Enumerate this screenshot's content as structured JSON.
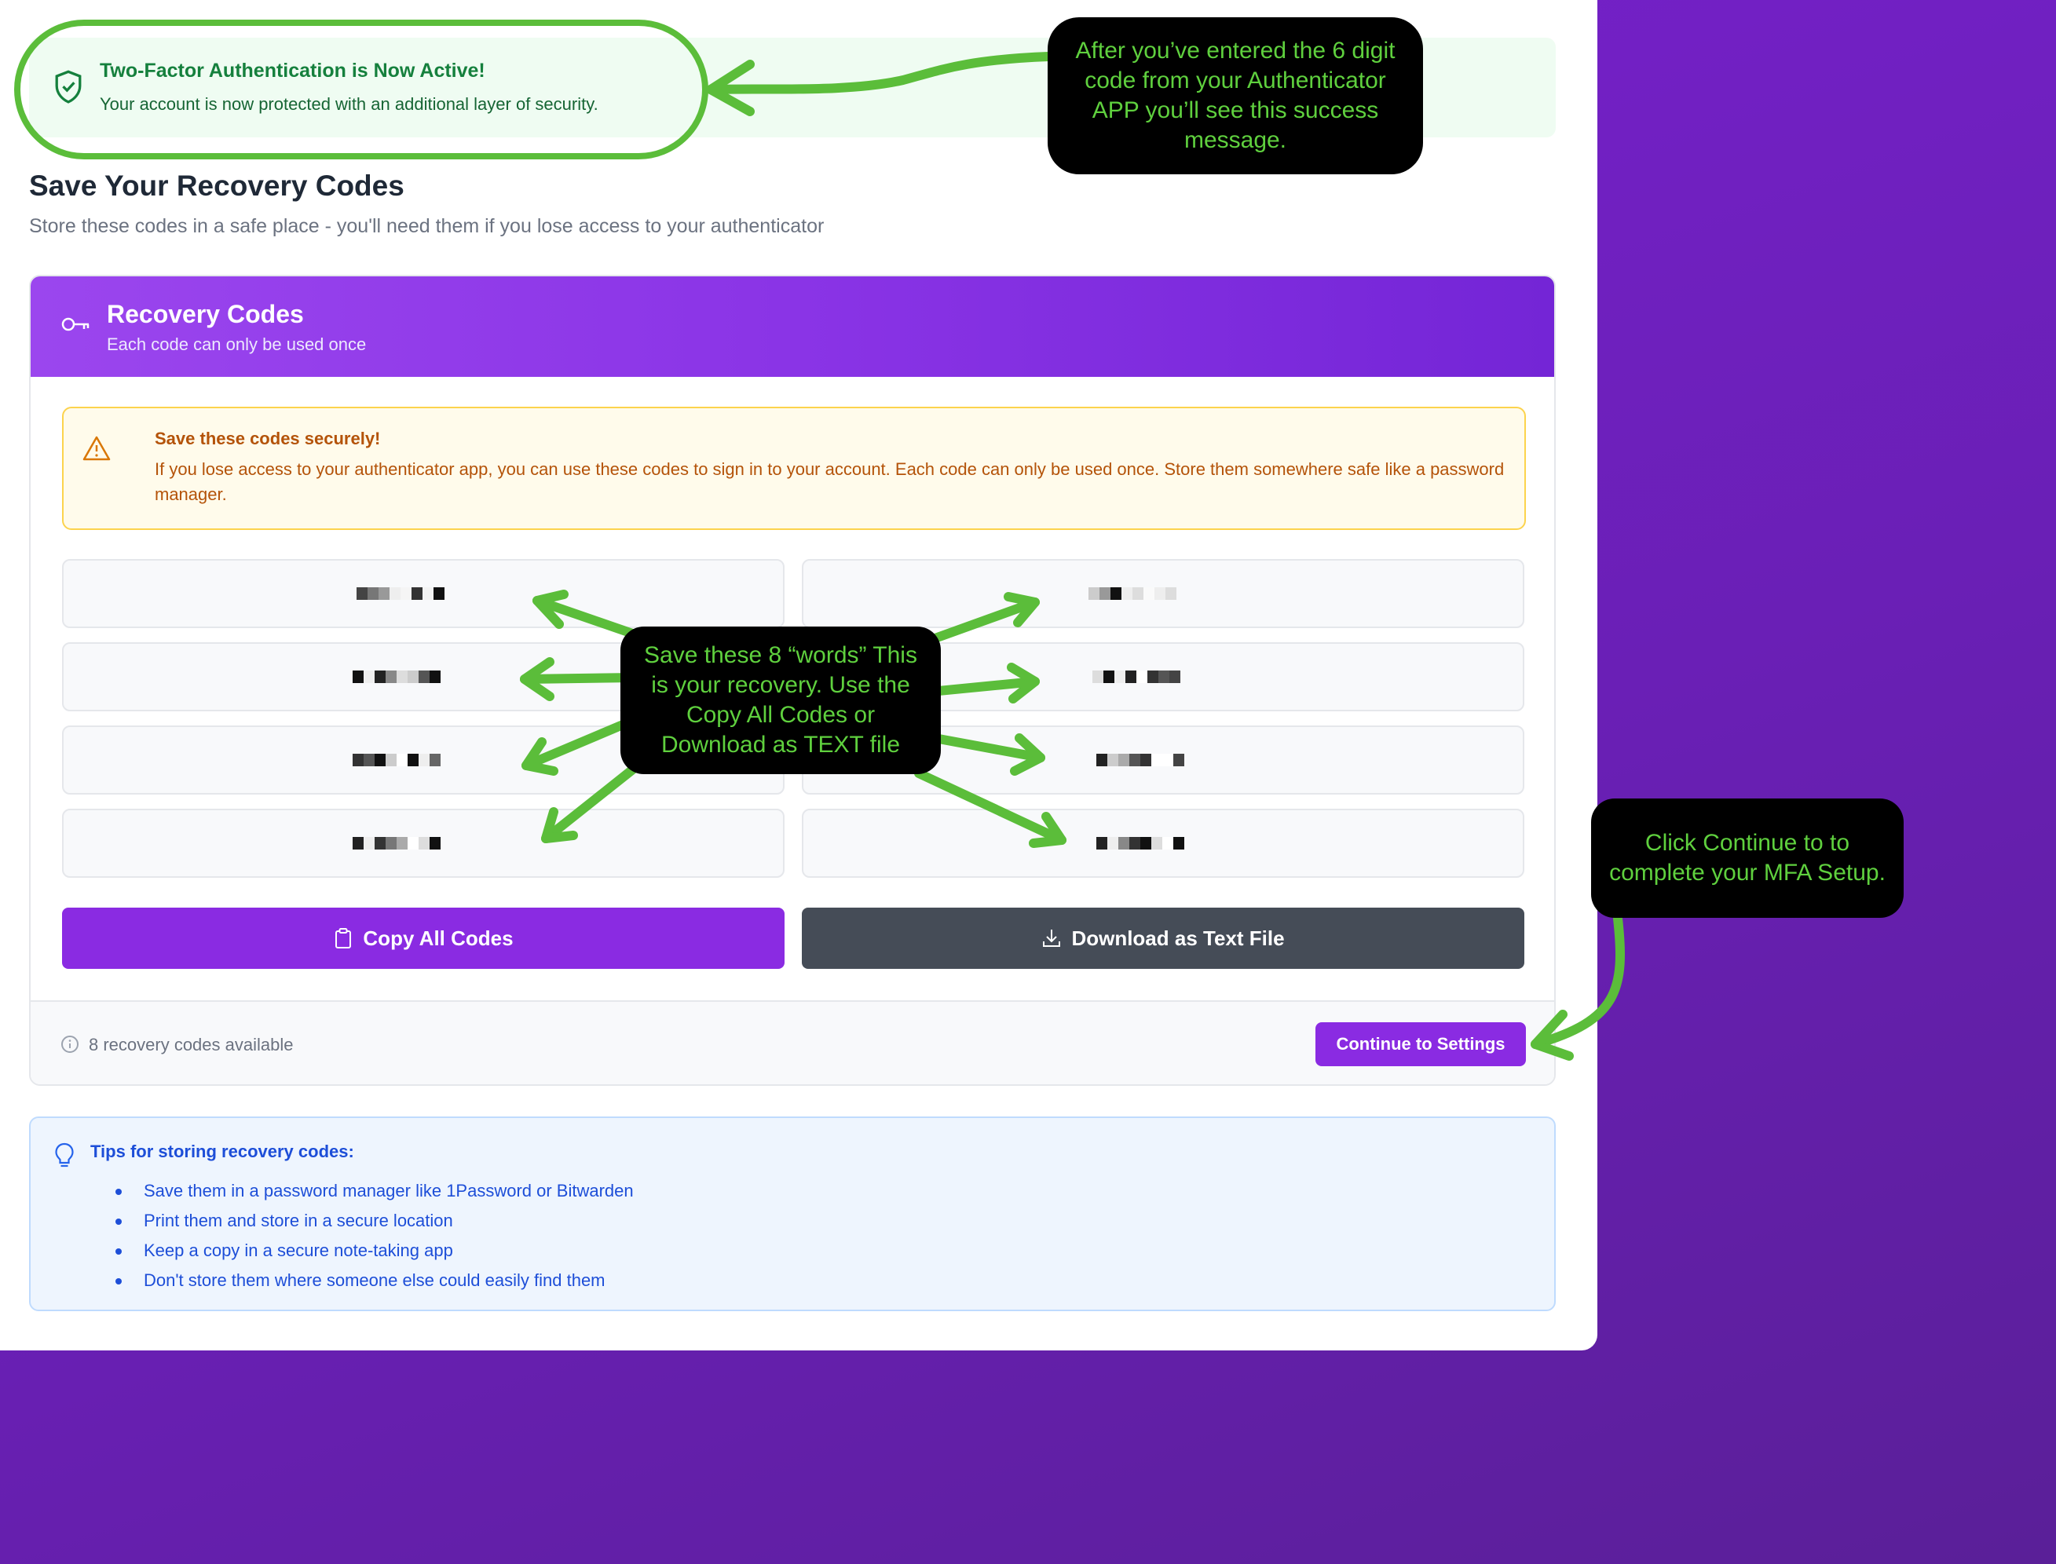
{
  "success": {
    "title": "Two-Factor Authentication is Now Active!",
    "description": "Your account is now protected with an additional layer of security."
  },
  "header": {
    "title": "Save Your Recovery Codes",
    "subtitle": "Store these codes in a safe place - you'll need them if you lose access to your authenticator"
  },
  "card": {
    "title": "Recovery Codes",
    "subtitle": "Each code can only be used once"
  },
  "warning": {
    "title": "Save these codes securely!",
    "body": "If you lose access to your authenticator app, you can use these codes to sign in to your account. Each code can only be used once. Store them somewhere safe like a password manager."
  },
  "codes": [
    "[redacted]",
    "[redacted]",
    "[redacted]",
    "[redacted]",
    "[redacted]",
    "[redacted]",
    "[redacted]",
    "[redacted]"
  ],
  "actions": {
    "copy_label": "Copy All Codes",
    "download_label": "Download as Text File"
  },
  "footer": {
    "available_text": "8 recovery codes available",
    "continue_label": "Continue to Settings"
  },
  "tips": {
    "title": "Tips for storing recovery codes:",
    "items": [
      "Save them in a password manager like 1Password or Bitwarden",
      "Print them and store in a secure location",
      "Keep a copy in a secure note-taking app",
      "Don't store them where someone else could easily find them"
    ]
  },
  "annotations": {
    "success_note": "After you’ve entered the 6 digit code from your Authenticator APP you’ll see this success message.",
    "codes_note": "Save these 8 “words” This is your recovery. Use the Copy All Codes or Download as TEXT file",
    "continue_note": "Click Continue to  to complete your MFA Setup."
  },
  "colors": {
    "accent": "#8a2be2",
    "annotation_green": "#5bbd3a",
    "success_green": "#15803d",
    "warning_text": "#b45309",
    "tips_blue": "#1d4ed8"
  }
}
